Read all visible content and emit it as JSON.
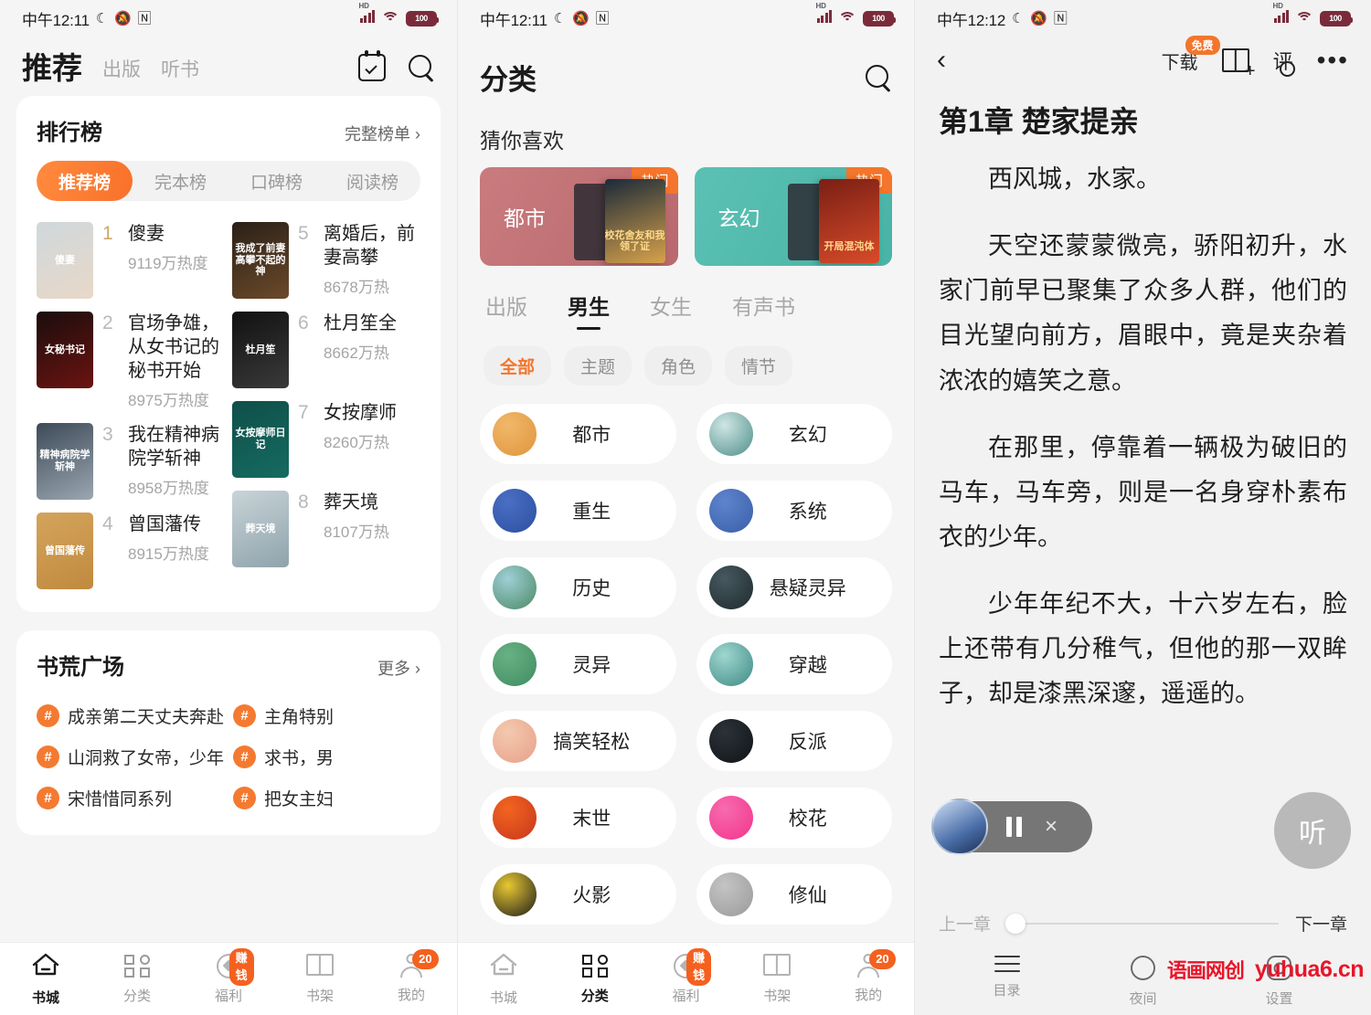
{
  "status_bar": {
    "time_1": "中午12:11",
    "time_2": "中午12:11",
    "time_3": "中午12:12",
    "moon_icon": "☾",
    "mute_icon": "⚡",
    "nfc_icon": "N",
    "hd_label": "HD",
    "battery": "100"
  },
  "panel1": {
    "title": "推荐",
    "tabs": [
      {
        "label": "出版"
      },
      {
        "label": "听书"
      }
    ],
    "icons": {
      "calendar": "calendar-icon",
      "search": "search-icon"
    },
    "rank_card": {
      "title": "排行榜",
      "more": "完整榜单 ›",
      "segments": [
        {
          "label": "推荐榜",
          "active": true
        },
        {
          "label": "完本榜",
          "active": false
        },
        {
          "label": "口碑榜",
          "active": false
        },
        {
          "label": "阅读榜",
          "active": false
        }
      ],
      "left_items": [
        {
          "num": "1",
          "name": "傻妻",
          "heat": "9119万热度",
          "cover_text": "傻妻",
          "c1": "#cfd8dc",
          "c2": "#e8d8c8"
        },
        {
          "num": "2",
          "name": "官场争雄，从女书记的秘书开始",
          "heat": "8975万热度",
          "cover_text": "女秘书记",
          "c1": "#1a0d0d",
          "c2": "#6b1410"
        },
        {
          "num": "3",
          "name": "我在精神病院学斩神",
          "heat": "8958万热度",
          "cover_text": "精神病院学斩神",
          "c1": "#3d4a57",
          "c2": "#9aa7b2"
        },
        {
          "num": "4",
          "name": "曾国藩传",
          "heat": "8915万热度",
          "cover_text": "曾国藩传",
          "c1": "#d4a45c",
          "c2": "#c08a3e"
        }
      ],
      "right_items": [
        {
          "num": "5",
          "name": "离婚后，前妻高攀",
          "heat": "8678万热",
          "cover_text": "我成了前妻高攀不起的神",
          "c1": "#2a2018",
          "c2": "#6b4a2a"
        },
        {
          "num": "6",
          "name": "杜月笙全",
          "heat": "8662万热",
          "cover_text": "杜月笙",
          "c1": "#111111",
          "c2": "#3a3a3a"
        },
        {
          "num": "7",
          "name": "女按摩师",
          "heat": "8260万热",
          "cover_text": "女按摩师日记",
          "c1": "#0f4f4a",
          "c2": "#156b60"
        },
        {
          "num": "8",
          "name": "葬天境",
          "heat": "8107万热",
          "cover_text": "葬天境",
          "c1": "#c8d4d8",
          "c2": "#8fa3ab"
        }
      ]
    },
    "tag_card": {
      "title": "书荒广场",
      "more": "更多 ›",
      "hash": "#",
      "left_tags": [
        {
          "text": "成亲第二天丈夫奔赴战场，…"
        },
        {
          "text": "山洞救了女帝，少年修为一…"
        },
        {
          "text": "宋惜惜同系列"
        }
      ],
      "right_tags": [
        {
          "text": "主角特别"
        },
        {
          "text": "求书，男"
        },
        {
          "text": "把女主妇"
        }
      ]
    },
    "nav": [
      {
        "label": "书城",
        "icon": "home-icon",
        "active": true,
        "badge": ""
      },
      {
        "label": "分类",
        "icon": "grid-icon",
        "active": false,
        "badge": ""
      },
      {
        "label": "福利",
        "icon": "coin-icon",
        "active": false,
        "badge": "赚钱"
      },
      {
        "label": "书架",
        "icon": "book-icon",
        "active": false,
        "badge": ""
      },
      {
        "label": "我的",
        "icon": "user-icon",
        "active": false,
        "badge": "20"
      }
    ]
  },
  "panel2": {
    "title": "分类",
    "search_icon": "search-icon",
    "section_label": "猜你喜欢",
    "banners": [
      {
        "name": "都市",
        "hot": "热门",
        "bg1": "#c97b7e",
        "bg2": "#b9696d",
        "book_text": "校花舍友和我领了证",
        "bc1": "#1b2a3a",
        "bc2": "#d8a24a"
      },
      {
        "name": "玄幻",
        "hot": "热门",
        "bg1": "#5bc1b4",
        "bg2": "#49b3a6",
        "book_text": "开局混沌体",
        "bc1": "#7a1f14",
        "bc2": "#d84b2a"
      }
    ],
    "tabs": [
      {
        "label": "出版",
        "active": false
      },
      {
        "label": "男生",
        "active": true
      },
      {
        "label": "女生",
        "active": false
      },
      {
        "label": "有声书",
        "active": false
      }
    ],
    "chips": [
      {
        "label": "全部",
        "active": true
      },
      {
        "label": "主题",
        "active": false
      },
      {
        "label": "角色",
        "active": false
      },
      {
        "label": "情节",
        "active": false
      }
    ],
    "categories": [
      {
        "label": "都市",
        "icon": "city-icon",
        "c1": "#e0953c",
        "c2": "#f0b86a"
      },
      {
        "label": "玄幻",
        "icon": "mountain-icon",
        "c1": "#4e8e8a",
        "c2": "#cfe6e4"
      },
      {
        "label": "重生",
        "icon": "butterfly-icon",
        "c1": "#2c4fa0",
        "c2": "#4a6fc4"
      },
      {
        "label": "系统",
        "icon": "gear-icon",
        "c1": "#3a5fa8",
        "c2": "#5d84cc"
      },
      {
        "label": "历史",
        "icon": "scroll-icon",
        "c1": "#4b8a63",
        "c2": "#9ecfd6"
      },
      {
        "label": "悬疑灵异",
        "icon": "mystery-box-icon",
        "c1": "#1f2a2e",
        "c2": "#46595f"
      },
      {
        "label": "灵异",
        "icon": "ghost-icon",
        "c1": "#3f8c63",
        "c2": "#69b183"
      },
      {
        "label": "穿越",
        "icon": "portal-icon",
        "c1": "#3e8a86",
        "c2": "#9fd6cf"
      },
      {
        "label": "搞笑轻松",
        "icon": "smile-icon",
        "c1": "#e8a08a",
        "c2": "#f3c9ae"
      },
      {
        "label": "反派",
        "icon": "villain-icon",
        "c1": "#101418",
        "c2": "#2b3238"
      },
      {
        "label": "末世",
        "icon": "flame-icon",
        "c1": "#c8361e",
        "c2": "#f2651f"
      },
      {
        "label": "校花",
        "icon": "schoolgirl-icon",
        "c1": "#f2348c",
        "c2": "#f76bae"
      },
      {
        "label": "火影",
        "icon": "naruto-icon",
        "c1": "#1b1b1b",
        "c2": "#e8c832"
      },
      {
        "label": "修仙",
        "icon": "cultivator-icon",
        "c1": "#9a9a9a",
        "c2": "#c4c4c4"
      }
    ],
    "nav": [
      {
        "label": "书城",
        "icon": "home-icon",
        "active": false,
        "badge": ""
      },
      {
        "label": "分类",
        "icon": "grid-icon",
        "active": true,
        "badge": ""
      },
      {
        "label": "福利",
        "icon": "coin-icon",
        "active": false,
        "badge": "赚钱"
      },
      {
        "label": "书架",
        "icon": "book-icon",
        "active": false,
        "badge": ""
      },
      {
        "label": "我的",
        "icon": "user-icon",
        "active": false,
        "badge": "20"
      }
    ]
  },
  "panel3": {
    "back_icon": "back-chevron-icon",
    "download_label": "下载",
    "free_badge": "免费",
    "bookmark_icon": "add-bookmark-icon",
    "comment_label": "评",
    "more_icon": "more-dots-icon",
    "chapter_title": "第1章 楚家提亲",
    "paragraphs": [
      "西风城，水家。",
      "天空还蒙蒙微亮，骄阳初升，水家门前早已聚集了众多人群，他们的目光望向前方，眉眼中，竟是夹杂着浓浓的嬉笑之意。",
      "在那里，停靠着一辆极为破旧的马车，马车旁，则是一名身穿朴素布衣的少年。",
      "少年年纪不大，十六岁左右，脸上还带有几分稚气，但他的那一双眸子，却是漆黑深邃，遥遥的。"
    ],
    "mini_player": {
      "pause_icon": "pause-icon",
      "close_icon": "close-icon",
      "thumb": "book-thumb"
    },
    "listen_fab": "听",
    "prev_chapter": "上一章",
    "next_chapter": "下一章",
    "tools": [
      {
        "label": "目录",
        "icon": "menu-icon"
      },
      {
        "label": "夜间",
        "icon": "moon-icon"
      },
      {
        "label": "设置",
        "icon": "gear-icon"
      }
    ],
    "watermark": {
      "cn": "语画网创",
      "en": "yuhua6.cn",
      "color": "#e8152a"
    }
  }
}
